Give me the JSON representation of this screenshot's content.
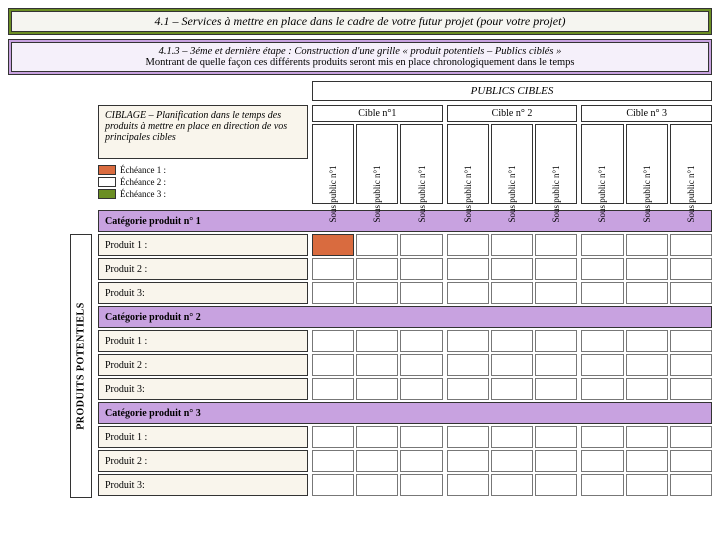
{
  "title": "4.1 – Services à mettre en place dans le cadre de votre futur projet (pour votre projet)",
  "subtitle": {
    "line1": "4.1.3 – 3éme et dernière étape : Construction d'une grille « produit potentiels – Publics ciblés »",
    "line2": "Montrant de quelle façon ces différents produits seront mis en place chronologiquement dans le temps"
  },
  "publics_header": "PUBLICS CIBLES",
  "cibles": [
    "Cible n°1",
    "Cible n° 2",
    "Cible n° 3"
  ],
  "sous_public_label": "Sous public n°1",
  "ciblage_text": "CIBLAGE – Planification dans le temps des produits à mettre en place en direction de vos principales cibles",
  "echeances": [
    "Échéance 1 :",
    "Échéance 2 :",
    "Échéance 3 :"
  ],
  "produits_side": "PRODUITS POTENTIELS",
  "rows": [
    {
      "type": "cat",
      "label": "Catégorie produit n° 1"
    },
    {
      "type": "prod",
      "label": "Produit 1 :",
      "first_orange": true
    },
    {
      "type": "prod",
      "label": "Produit 2 :"
    },
    {
      "type": "prod",
      "label": "Produit 3:"
    },
    {
      "type": "cat",
      "label": "Catégorie produit n° 2"
    },
    {
      "type": "prod",
      "label": "Produit 1 :"
    },
    {
      "type": "prod",
      "label": "Produit 2 :"
    },
    {
      "type": "prod",
      "label": "Produit 3:"
    },
    {
      "type": "cat",
      "label": "Catégorie produit n° 3"
    },
    {
      "type": "prod",
      "label": "Produit 1 :"
    },
    {
      "type": "prod",
      "label": "Produit 2 :"
    },
    {
      "type": "prod",
      "label": "Produit 3:"
    }
  ]
}
